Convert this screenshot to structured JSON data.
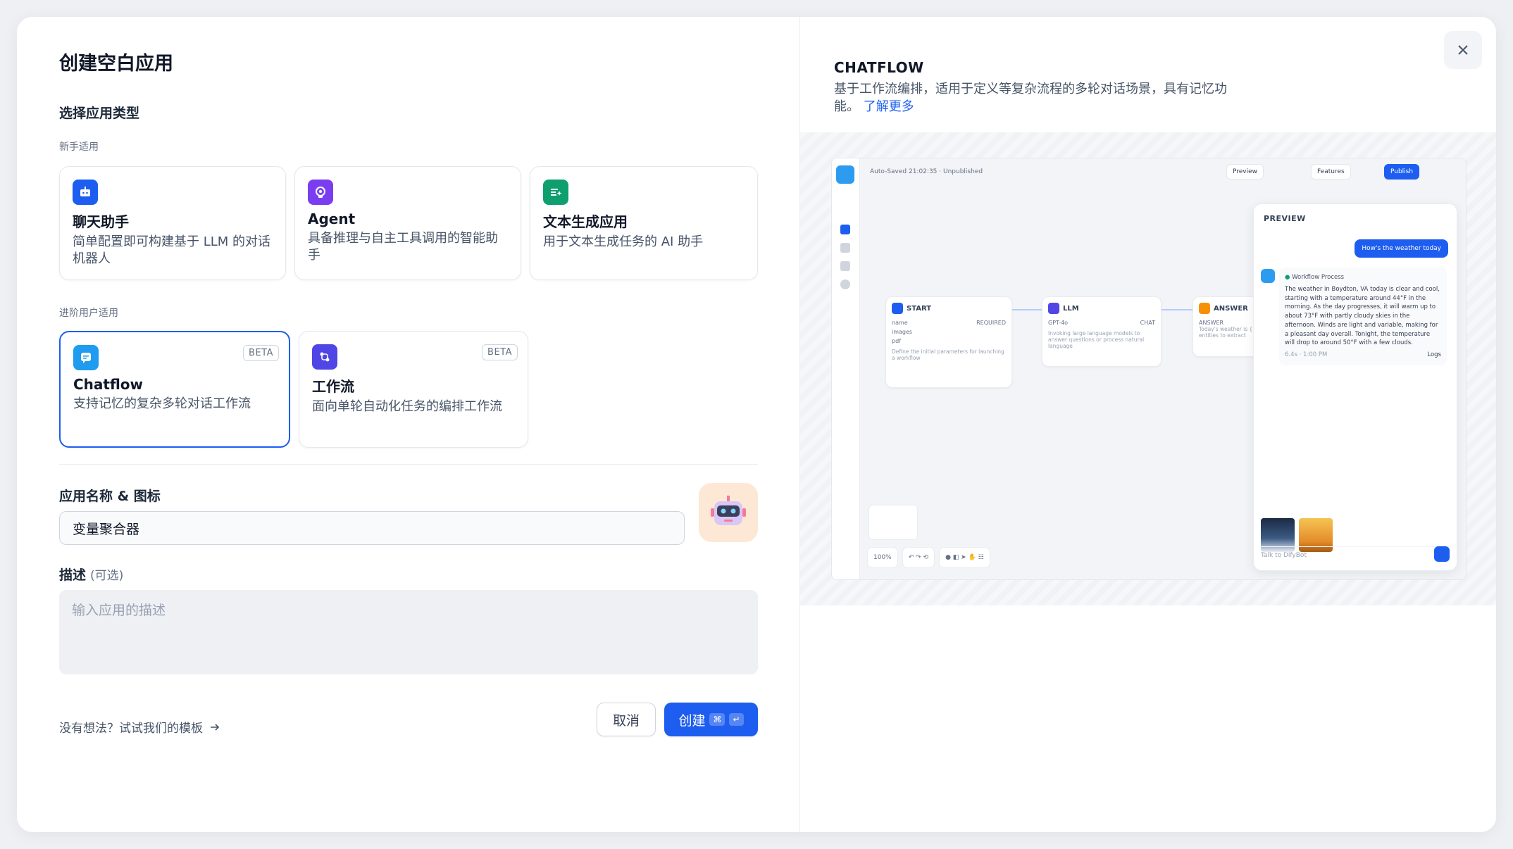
{
  "dialog": {
    "title": "创建空白应用",
    "type_section_title": "选择应用类型",
    "beginner_label": "新手适用",
    "advanced_label": "进阶用户适用"
  },
  "app_types": [
    {
      "id": "chat",
      "title": "聊天助手",
      "desc": "简单配置即可构建基于 LLM 的对话机器人",
      "icon": "chat-bot-icon",
      "color": "#1d5ef0"
    },
    {
      "id": "agent",
      "title": "Agent",
      "desc": "具备推理与自主工具调用的智能助手",
      "icon": "agent-icon",
      "color": "#7a3ef0"
    },
    {
      "id": "text",
      "title": "文本生成应用",
      "desc": "用于文本生成任务的 AI 助手",
      "icon": "text-generation-icon",
      "color": "#0e9f6e"
    },
    {
      "id": "chatflow",
      "title": "Chatflow",
      "desc": "支持记忆的复杂多轮对话工作流",
      "badge": "BETA",
      "icon": "chatflow-icon",
      "color": "#1f9bf0"
    },
    {
      "id": "workflow",
      "title": "工作流",
      "desc": "面向单轮自动化任务的编排工作流",
      "badge": "BETA",
      "icon": "workflow-icon",
      "color": "#4f46e5"
    }
  ],
  "form": {
    "name_label": "应用名称 & 图标",
    "name_value": "变量聚合器",
    "desc_label": "描述",
    "desc_optional": "(可选)",
    "desc_placeholder": "输入应用的描述"
  },
  "footer": {
    "templates_link": "没有想法？试试我们的模板",
    "cancel": "取消",
    "create": "创建",
    "shortcut_cmd": "⌘",
    "shortcut_enter": "↵"
  },
  "preview": {
    "title": "CHATFLOW",
    "desc": "基于工作流编排，适用于定义等复杂流程的多轮对话场景，具有记忆功能。",
    "learn_more": "了解更多",
    "mock": {
      "autosave": "Auto-Saved 21:02:35 · Unpublished",
      "preview_btn": "Preview",
      "features_btn": "Features",
      "publish_btn": "Publish",
      "node_start": "START",
      "node_llm": "LLM",
      "node_answer": "ANSWER",
      "llm_model": "GPT-4o",
      "start_fields": [
        "name",
        "images",
        "pdf"
      ],
      "start_field_tag": "REQUIRED",
      "start_desc": "Define the initial parameters for launching a workflow",
      "llm_tag": "CHAT",
      "llm_desc": "Invoking large language models to answer questions or process natural language",
      "answer_label": "ANSWER",
      "answer_desc": "Today's weather is {{ entities to extract",
      "panel_title": "PREVIEW",
      "user_msg": "How's the weather today",
      "process_label": "Workflow Process",
      "answer_text": "The weather in Boydton, VA today is clear and cool, starting with a temperature around 44°F in the morning. As the day progresses, it will warm up to about 73°F with partly cloudy skies in the afternoon. Winds are light and variable, making for a pleasant day overall. Tonight, the temperature will drop to around 50°F with a few clouds.",
      "answer_meta": "6.4s · 1:00 PM",
      "logs_label": "Logs",
      "input_placeholder": "Talk to DifyBot",
      "zoom": "100%"
    }
  }
}
